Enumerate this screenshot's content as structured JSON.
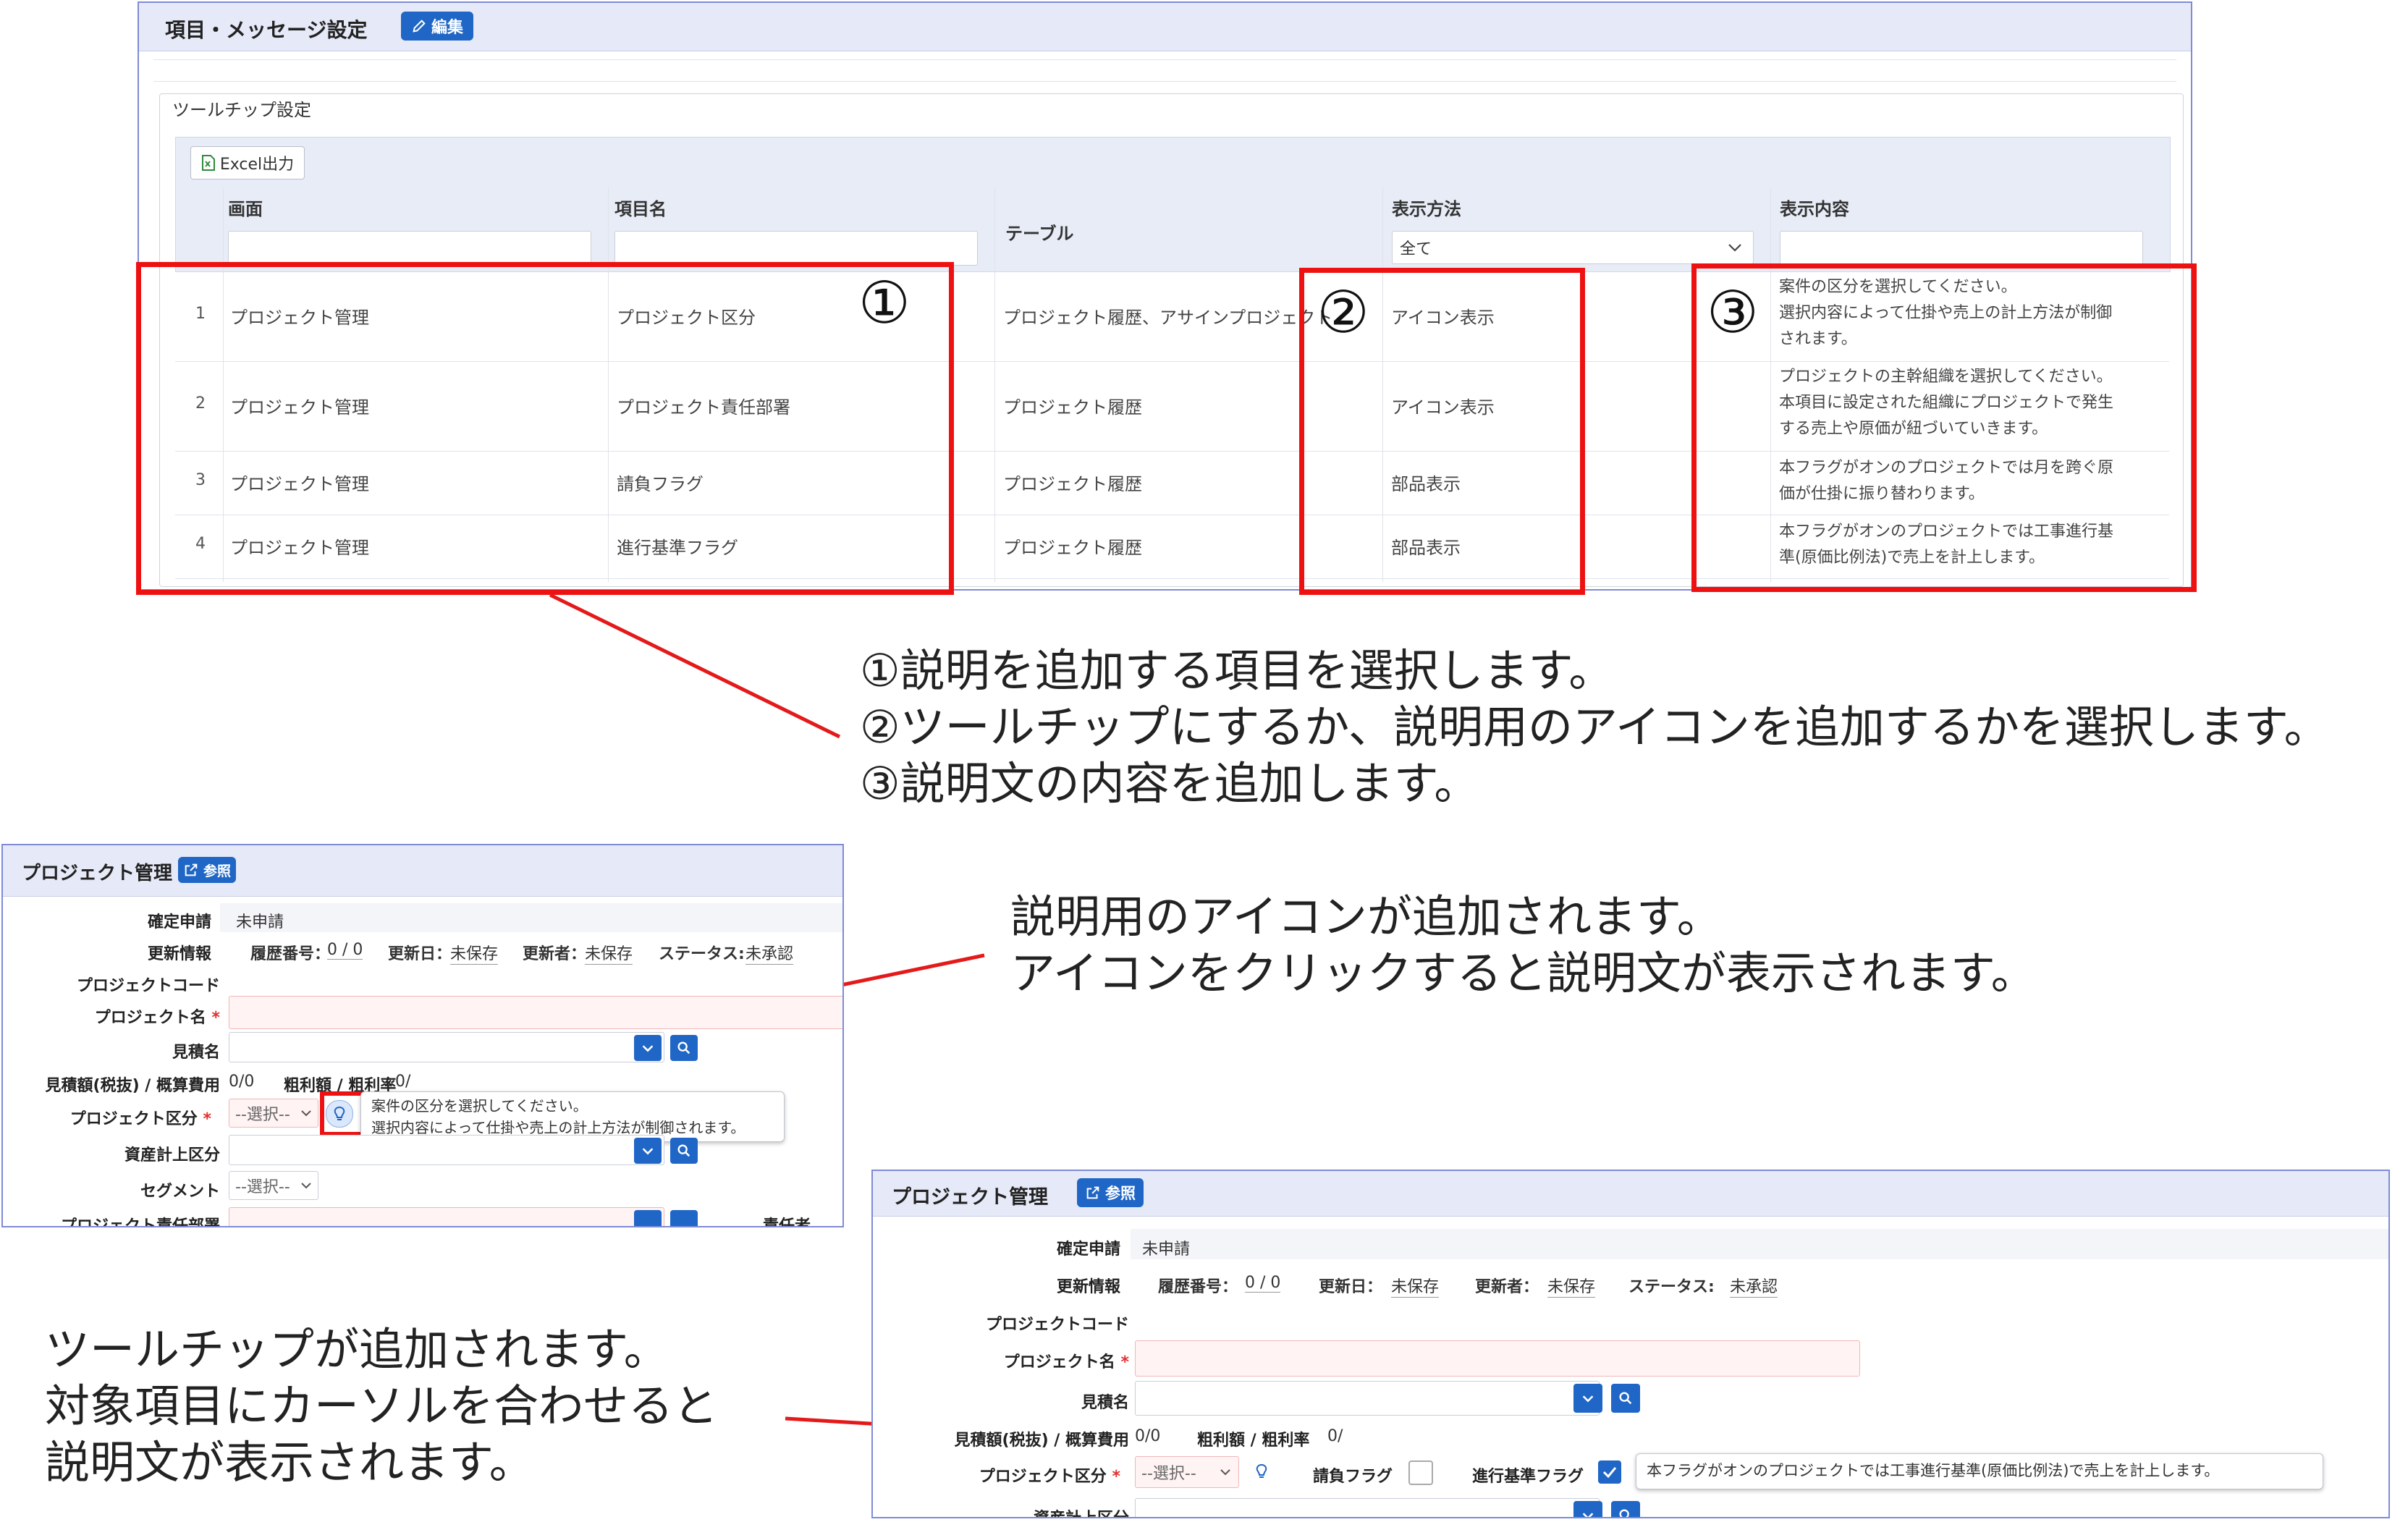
{
  "top_panel": {
    "title": "項目・メッセージ設定",
    "edit_button": "編集",
    "section_legend": "ツールチップ設定",
    "excel_button": "Excel出力",
    "columns": {
      "screen": "画面",
      "item_name": "項目名",
      "table": "テーブル",
      "display_method": "表示方法",
      "display_content": "表示内容"
    },
    "display_method_filter": "全て",
    "rows": [
      {
        "no": "1",
        "screen": "プロジェクト管理",
        "item": "プロジェクト区分",
        "table": "プロジェクト履歴、アサインプロジェクト",
        "method": "アイコン表示",
        "desc": [
          "案件の区分を選択してください。",
          "選択内容によって仕掛や売上の計上方法が制御",
          "されます。"
        ]
      },
      {
        "no": "2",
        "screen": "プロジェクト管理",
        "item": "プロジェクト責任部署",
        "table": "プロジェクト履歴",
        "method": "アイコン表示",
        "desc": [
          "プロジェクトの主幹組織を選択してください。",
          "本項目に設定された組織にプロジェクトで発生",
          "する売上や原価が紐づいていきます。"
        ]
      },
      {
        "no": "3",
        "screen": "プロジェクト管理",
        "item": "請負フラグ",
        "table": "プロジェクト履歴",
        "method": "部品表示",
        "desc": [
          "本フラグがオンのプロジェクトでは月を跨ぐ原",
          "価が仕掛に振り替わります。"
        ]
      },
      {
        "no": "4",
        "screen": "プロジェクト管理",
        "item": "進行基準フラグ",
        "table": "プロジェクト履歴",
        "method": "部品表示",
        "desc": [
          "本フラグがオンのプロジェクトでは工事進行基",
          "準(原価比例法)で売上を計上します。"
        ]
      }
    ]
  },
  "annotations": {
    "markers": [
      "①",
      "②",
      "③"
    ],
    "explain_lines": [
      "①説明を追加する項目を選択します。",
      "②ツールチップにするか、説明用のアイコンを追加するかを選択します。",
      "③説明文の内容を追加します。"
    ],
    "icon_note": [
      "説明用のアイコンが追加されます。",
      "アイコンをクリックすると説明文が表示されます。"
    ],
    "tooltip_note": [
      "ツールチップが追加されます。",
      "対象項目にカーソルを合わせると",
      "説明文が表示されます。"
    ]
  },
  "form": {
    "title": "プロジェクト管理",
    "ref_button": "参照",
    "labels": {
      "confirm": "確定申請",
      "update_info": "更新情報",
      "project_code": "プロジェクトコード",
      "project_name": "プロジェクト名",
      "estimate_name": "見積名",
      "estimate_amount": "見積額(税抜) / 概算費用",
      "project_type": "プロジェクト区分",
      "asset_type": "資産計上区分",
      "segment": "セグメント",
      "contract_flag": "請負フラグ",
      "progress_flag": "進行基準フラグ",
      "gross_profit": "粗利額 / 粗利率"
    },
    "confirm_value": "未申請",
    "history_label": "履歴番号：",
    "history_value": "0 / 0",
    "updated_label": "更新日：",
    "updated_value": "未保存",
    "updater_label": "更新者：",
    "updater_value": "未保存",
    "status_label": "ステータス:",
    "status_value": "未承認",
    "estimate_amount_value": "0/0",
    "gross_profit_value": "0/",
    "select_placeholder": "--選択--",
    "required_mark": "*",
    "icon_tooltip": [
      "案件の区分を選択してください。",
      "選択内容によって仕掛や売上の計上方法が制御されます。"
    ],
    "hover_tooltip": "本フラグがオンのプロジェクトでは工事進行基準(原価比例法)で売上を計上します。",
    "cut_label": "プロジェクト責任部署",
    "cut_label2": "責任者"
  },
  "colors": {
    "accent": "#1f66c6",
    "highlight_red": "#ee1111",
    "header_bg": "#e6e9f7",
    "panel_border": "#7f8bd6"
  }
}
